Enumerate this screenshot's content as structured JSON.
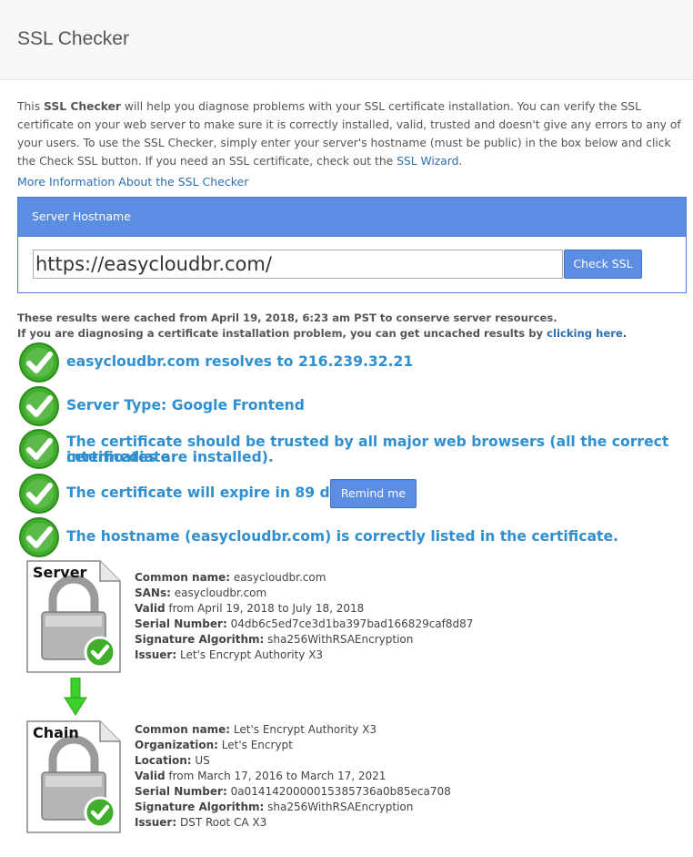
{
  "header": {
    "title": "SSL Checker"
  },
  "intro": {
    "p1": "This ",
    "bold": "SSL Checker",
    "p2": " will help you diagnose problems with your SSL certificate installation. You can verify the SSL certificate on your web server to make sure it is correctly installed, valid, trusted and doesn't give any errors to any of your users. To use the SSL Checker, simply enter your server's hostname (must be public) in the box below and click the Check SSL button. If you need an SSL certificate, check out the ",
    "wizard_link": "SSL Wizard",
    "p3": "."
  },
  "more_info_link": "More Information About the SSL Checker",
  "panel": {
    "heading": "Server Hostname",
    "hostname_value": "https://easycloudbr.com/",
    "check_button": "Check SSL"
  },
  "cached": {
    "line1": "These results were cached from April 19, 2018, 6:23 am PST to conserve server resources.",
    "line2_prefix": "If you are diagnosing a certificate installation problem, you can get uncached results by ",
    "line2_link": "clicking here",
    "line2_suffix": "."
  },
  "results": [
    "easycloudbr.com resolves to 216.239.32.21",
    "Server Type: Google Frontend",
    "The certificate should be trusted by all major web browsers (all the correct intermediate",
    "certificates are installed).",
    "The certificate will expire in 89 days.",
    "The hostname (easycloudbr.com) is correctly listed in the certificate."
  ],
  "remind_button": "Remind me",
  "server_cert": {
    "label": "Server",
    "rows": [
      {
        "k": "Common name:",
        "v": " easycloudbr.com"
      },
      {
        "k": "SANs:",
        "v": " easycloudbr.com"
      },
      {
        "k": "Valid",
        "v": " from April 19, 2018 to July 18, 2018"
      },
      {
        "k": "Serial Number:",
        "v": " 04db6c5ed7ce3d1ba397bad166829caf8d87"
      },
      {
        "k": "Signature Algorithm:",
        "v": " sha256WithRSAEncryption"
      },
      {
        "k": "Issuer:",
        "v": " Let's Encrypt Authority X3"
      }
    ]
  },
  "chain_cert": {
    "label": "Chain",
    "rows": [
      {
        "k": "Common name:",
        "v": " Let's Encrypt Authority X3"
      },
      {
        "k": "Organization:",
        "v": " Let's Encrypt"
      },
      {
        "k": "Location:",
        "v": " US"
      },
      {
        "k": "Valid",
        "v": " from March 17, 2016 to March 17, 2021"
      },
      {
        "k": "Serial Number:",
        "v": " 0a0141420000015385736a0b85eca708"
      },
      {
        "k": "Signature Algorithm:",
        "v": " sha256WithRSAEncryption"
      },
      {
        "k": "Issuer:",
        "v": " DST Root CA X3"
      }
    ]
  },
  "icons": {
    "check": "green-check-icon",
    "cert": "padlock-certificate-icon",
    "arrow": "green-down-arrow-icon"
  },
  "colors": {
    "accent": "#5b8de2",
    "result_text": "#2f8fd0",
    "check_green": "#3fae2a"
  }
}
